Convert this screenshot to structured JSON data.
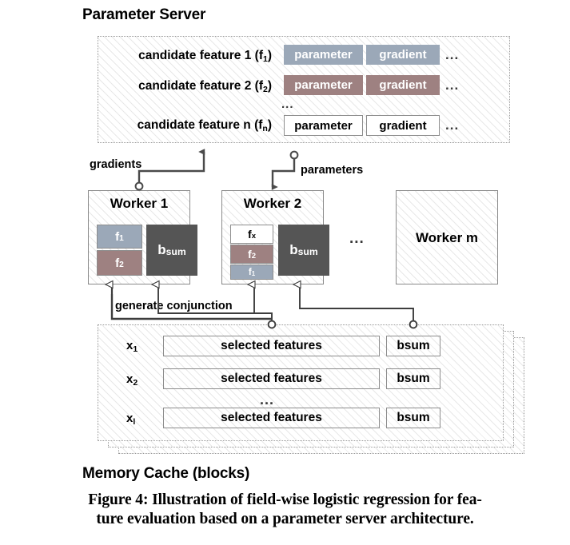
{
  "figure": {
    "caption_line1": "Figure 4: Illustration of field-wise logistic regression for fea-",
    "caption_line2": "ture evaluation based on a parameter server architecture."
  },
  "colors": {
    "feature_blue": "#9ba8b8",
    "feature_mauve": "#9e8181",
    "bsum_gray": "#555555",
    "box_border": "#8d8d8d",
    "dashed_border": "#9a9a9a",
    "connector": "#4a4a4a",
    "text": "#000000"
  },
  "parameter_server": {
    "heading": "Parameter Server",
    "rows": [
      {
        "label": "candidate feature 1 (f",
        "label_sub": "1",
        "label_suffix": ")",
        "parameter": "parameter",
        "gradient": "gradient",
        "ellipsis": "...",
        "style": "blue"
      },
      {
        "label": "candidate feature 2 (f",
        "label_sub": "2",
        "label_suffix": ")",
        "parameter": "parameter",
        "gradient": "gradient",
        "ellipsis": "...",
        "style": "mauve"
      },
      {
        "label": "candidate feature n (f",
        "label_sub": "n",
        "label_suffix": ")",
        "parameter": "parameter",
        "gradient": "gradient",
        "ellipsis": "...",
        "style": "plain"
      }
    ],
    "row_ellipsis": "..."
  },
  "connectors": {
    "gradients_label": "gradients",
    "parameters_label": "parameters",
    "generate_conjunction_label": "generate conjunction"
  },
  "workers": {
    "worker1": {
      "title": "Worker 1",
      "features": [
        {
          "name": "f",
          "sub": "1",
          "style": "blue"
        },
        {
          "name": "f",
          "sub": "2",
          "style": "mauve"
        }
      ],
      "bsum": {
        "name": "b",
        "sub": "sum"
      }
    },
    "worker2": {
      "title": "Worker 2",
      "features": [
        {
          "name": "f",
          "sub": "x",
          "style": "plain"
        },
        {
          "name": "f",
          "sub": "2",
          "style": "mauve"
        },
        {
          "name": "f",
          "sub": "1",
          "style": "blue"
        }
      ],
      "bsum": {
        "name": "b",
        "sub": "sum"
      }
    },
    "ellipsis": "...",
    "workerm": {
      "title": "Worker m"
    }
  },
  "memory_cache": {
    "heading": "Memory Cache (blocks)",
    "layer_count": 3,
    "rows": [
      {
        "label": "x",
        "sub": "1",
        "features": "selected features",
        "bsum": "bsum"
      },
      {
        "label": "x",
        "sub": "2",
        "features": "selected features",
        "bsum": "bsum"
      },
      {
        "label": "x",
        "sub": "l",
        "features": "selected features",
        "bsum": "bsum"
      }
    ],
    "row_ellipsis": "..."
  }
}
